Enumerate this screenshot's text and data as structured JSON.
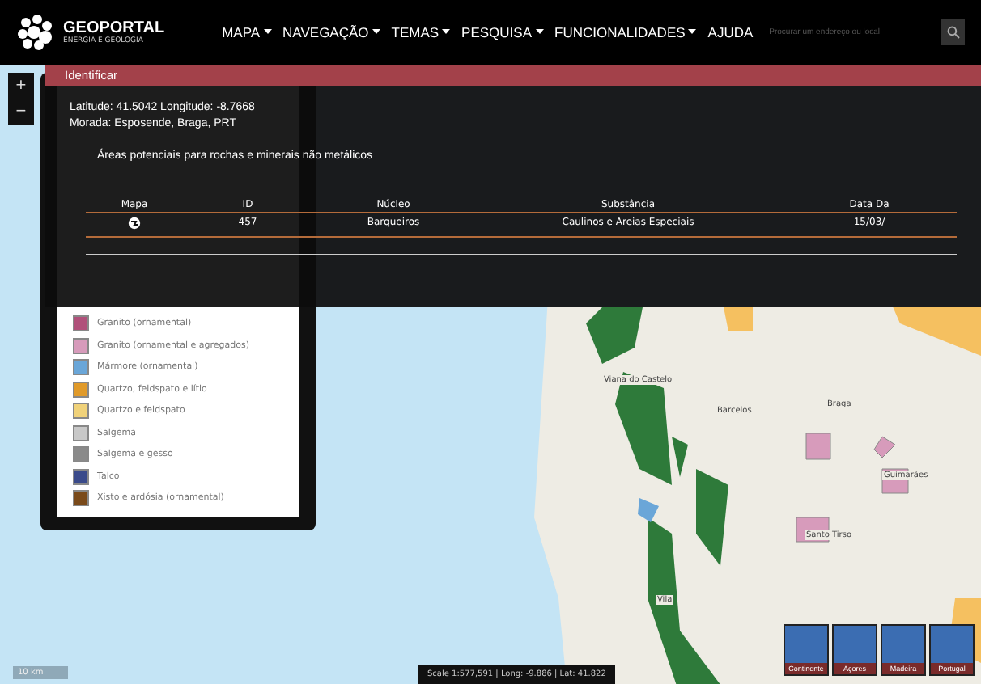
{
  "header": {
    "logo_title": "GEOPORTAL",
    "logo_subtitle": "ENERGIA E GEOLOGIA",
    "menu": [
      {
        "label": "MAPA",
        "dropdown": true
      },
      {
        "label": "NAVEGAÇÃO",
        "dropdown": true
      },
      {
        "label": "TEMAS",
        "dropdown": true
      },
      {
        "label": "PESQUISA",
        "dropdown": true
      },
      {
        "label": "FUNCIONALIDADES",
        "dropdown": true
      },
      {
        "label": "AJUDA",
        "dropdown": false
      }
    ],
    "search": {
      "placeholder": "Procurar um endereço ou local"
    }
  },
  "zoom": {
    "plus": "+",
    "minus": "−"
  },
  "legend": {
    "items": [
      {
        "label": "Granito (ornamental)",
        "color": "#b0507a"
      },
      {
        "label": "Granito (ornamental e agregados)",
        "color": "#d79bbb"
      },
      {
        "label": "Mármore (ornamental)",
        "color": "#6aa6d8"
      },
      {
        "label": "Quartzo, feldspato e lítio",
        "color": "#e09a2a"
      },
      {
        "label": "Quartzo e feldspato",
        "color": "#f0d27a"
      },
      {
        "label": "Salgema",
        "color": "#c8c8c8"
      },
      {
        "label": "Salgema e gesso",
        "color": "#8a8a8a"
      },
      {
        "label": "Talco",
        "color": "#3a4a8a"
      },
      {
        "label": "Xisto e ardósia (ornamental)",
        "color": "#7a4a1a"
      }
    ]
  },
  "popup": {
    "title": "Identificar",
    "coordinates": "Latitude: 41.5042  Longitude: -8.7668",
    "address": "Morada: Esposende, Braga, PRT",
    "layer": "Áreas potenciais para rochas e minerais não metálicos",
    "table": {
      "columns": [
        "Mapa",
        "ID",
        "Núcleo",
        "Substância",
        "Data Da"
      ],
      "rows": [
        {
          "id": "457",
          "nucleo": "Barqueiros",
          "substancia": "Caulinos e Areias Especiais",
          "data": "15/03/"
        }
      ]
    }
  },
  "map": {
    "places": [
      "Viana do Castelo",
      "Barcelos",
      "Braga",
      "Guimarães",
      "Santo Tirso",
      "Vila"
    ],
    "scale_bar": "10 km",
    "status": "Scale 1:577,591 | Long: -9.886 | Lat: 41.822"
  },
  "basemaps": [
    {
      "label": "Continente"
    },
    {
      "label": "Açores"
    },
    {
      "label": "Madeira"
    },
    {
      "label": "Portugal"
    }
  ]
}
